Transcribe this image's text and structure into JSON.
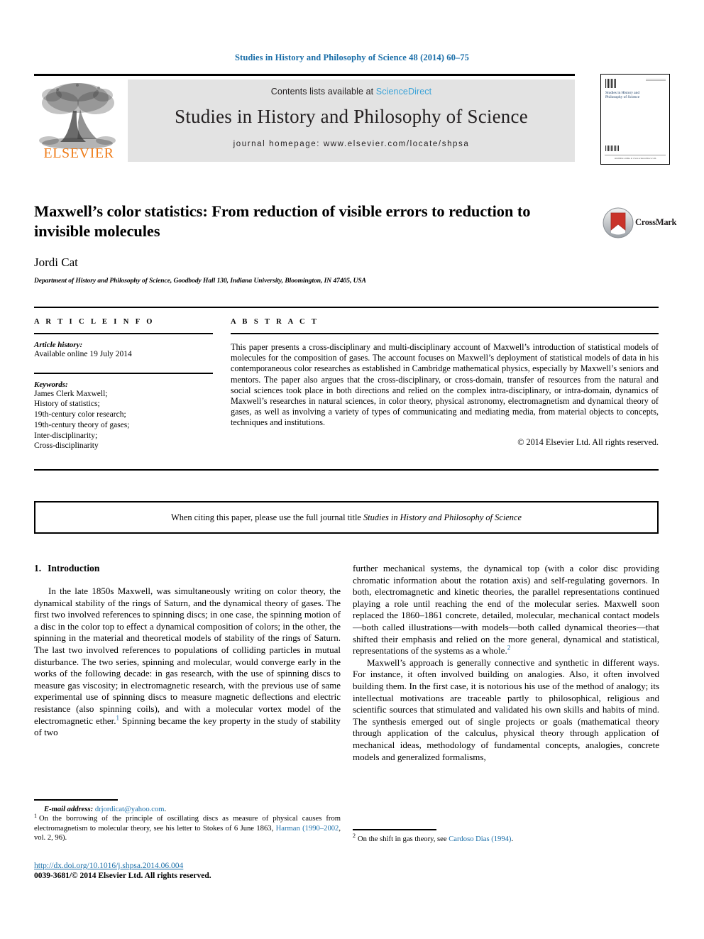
{
  "running_head": "Studies in History and Philosophy of Science 48 (2014) 60–75",
  "masthead": {
    "contents_prefix": "Contents lists available at ",
    "sciencedirect": "ScienceDirect",
    "journal_title": "Studies in History and Philosophy of Science",
    "homepage": "journal homepage: www.elsevier.com/locate/shpsa",
    "publisher_name": "ELSEVIER",
    "publisher_color": "#ef7d1a",
    "link_color": "#3ba3d8",
    "band_color": "#e3e3e3",
    "cover": {
      "title": "Studies in History and Philosophy of Science",
      "footer": "Available online at www.sciencedirect.com"
    }
  },
  "article": {
    "title": "Maxwell’s color statistics: From reduction of visible errors to reduction to invisible molecules",
    "author": "Jordi Cat",
    "affiliation": "Department of History and Philosophy of Science, Goodbody Hall 130, Indiana University, Bloomington, IN 47405, USA",
    "crossmark_label": "CrossMark"
  },
  "info": {
    "heading": "A R T I C L E  I N F O",
    "history_label": "Article history:",
    "history_value": "Available online 19 July 2014",
    "keywords_label": "Keywords:",
    "keywords": [
      "James Clerk Maxwell;",
      "History of statistics;",
      "19th-century color research;",
      "19th-century theory of gases;",
      "Inter-disciplinarity;",
      "Cross-disciplinarity"
    ]
  },
  "abstract": {
    "heading": "A B S T R A C T",
    "body": "This paper presents a cross-disciplinary and multi-disciplinary account of Maxwell’s introduction of statistical models of molecules for the composition of gases. The account focuses on Maxwell’s deployment of statistical models of data in his contemporaneous color researches as established in Cambridge mathematical physics, especially by Maxwell’s seniors and mentors. The paper also argues that the cross-disciplinary, or cross-domain, transfer of resources from the natural and social sciences took place in both directions and relied on the complex intra-disciplinary, or intra-domain, dynamics of Maxwell’s researches in natural sciences, in color theory, physical astronomy, electromagnetism and dynamical theory of gases, as well as involving a variety of types of communicating and mediating media, from material objects to concepts, techniques and institutions.",
    "copyright": "© 2014 Elsevier Ltd. All rights reserved."
  },
  "citation_notice": {
    "prefix": "When citing this paper, please use the full journal title ",
    "journal": "Studies in History and Philosophy of Science"
  },
  "body": {
    "section_number": "1.",
    "section_title": "Introduction",
    "left_paragraph": "In the late 1850s Maxwell, was simultaneously writing on color theory, the dynamical stability of the rings of Saturn, and the dynamical theory of gases. The first two involved references to spinning discs; in one case, the spinning motion of a disc in the color top to effect a dynamical composition of colors; in the other, the spinning in the material and theoretical models of stability of the rings of Saturn. The last two involved references to populations of colliding particles in mutual disturbance. The two series, spinning and molecular, would converge early in the works of the following decade: in gas research, with the use of spinning discs to measure gas viscosity; in electromagnetic research, with the previous use of same experimental use of spinning discs to measure magnetic deflections and electric resistance (also spinning coils), and with a molecular vortex model of the electromagnetic ether.",
    "left_paragraph_tail": "Spinning became the key property in the study of stability of two",
    "left_footnote_marker": "1",
    "right_paragraph_1": "further mechanical systems, the dynamical top (with a color disc providing chromatic information about the rotation axis) and self-regulating governors. In both, electromagnetic and kinetic theories, the parallel representations continued playing a role until reaching the end of the molecular series. Maxwell soon replaced the 1860–1861 concrete, detailed, molecular, mechanical contact models—both called illustrations—with models—both called dynamical theories—that shifted their emphasis and relied on the more general, dynamical and statistical, representations of the systems as a whole.",
    "right_footnote_marker_1": "2",
    "right_paragraph_2": "Maxwell’s approach is generally connective and synthetic in different ways. For instance, it often involved building on analogies. Also, it often involved building them. In the first case, it is notorious his use of the method of analogy; its intellectual motivations are traceable partly to philosophical, religious and scientific sources that stimulated and validated his own skills and habits of mind. The synthesis emerged out of single projects or goals (mathematical theory through application of the calculus, physical theory through application of mechanical ideas, methodology of fundamental concepts, analogies, concrete models and generalized formalisms,"
  },
  "footnotes": {
    "email_label": "E-mail address:",
    "email": "drjordicat@yahoo.com",
    "email_suffix": ".",
    "note1_number": "1",
    "note1_text_a": "On the borrowing of the principle of oscillating discs as measure of physical causes from electromagnetism to molecular theory, see his letter to Stokes of 6 June 1863, ",
    "note1_ref": "Harman (1990–2002",
    "note1_text_b": ", vol. 2, 96).",
    "note2_number": "2",
    "note2_text_a": "On the shift in gas theory, see ",
    "note2_ref": "Cardoso Dias (1994)",
    "note2_text_b": "."
  },
  "footer": {
    "doi": "http://dx.doi.org/10.1016/j.shpsa.2014.06.004",
    "issn": "0039-3681/© 2014 Elsevier Ltd. All rights reserved.",
    "link_color": "#1a6ea8"
  }
}
